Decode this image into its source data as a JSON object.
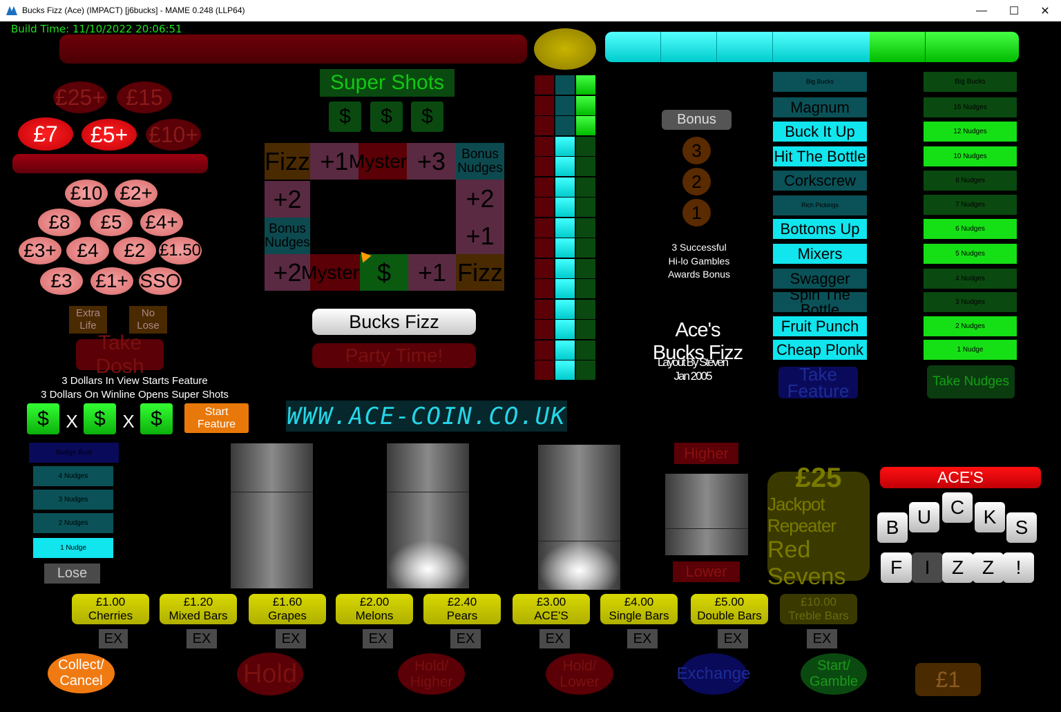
{
  "window": {
    "title": "Bucks Fizz (Ace) (IMPACT) [j6bucks] - MAME 0.248 (LLP64)",
    "minimize": "—",
    "maximize": "☐",
    "close": "✕"
  },
  "build_time": "Build Time: 11/10/2022 20:06:51",
  "cash_ladder": {
    "top": [
      {
        "label": "£25+",
        "lit": false
      },
      {
        "label": "£15",
        "lit": false
      }
    ],
    "row2": [
      {
        "label": "£7",
        "lit": true
      },
      {
        "label": "£5+",
        "lit": true
      },
      {
        "label": "£10+",
        "lit": false
      }
    ]
  },
  "pink_awards": [
    "£10",
    "£2+",
    "£8",
    "£5",
    "£4+",
    "£3+",
    "£4",
    "£2",
    "£1.50",
    "£3",
    "£1+",
    "SSO"
  ],
  "extra_life": "Extra Life",
  "no_lose": "No Lose",
  "take_dosh": "Take Dosh",
  "dollar_info_1": "3 Dollars In View Starts Feature",
  "dollar_info_2": "3 Dollars On Winline Opens Super Shots",
  "dollar_symbol": "$",
  "times": "X",
  "start_feature": "Start Feature",
  "super_shots": "Super Shots",
  "trail": {
    "top": [
      "Fizz",
      "+1",
      "Mystery",
      "+3",
      "Bonus Nudges"
    ],
    "right": [
      "+2",
      "+1"
    ],
    "left": [
      "+2",
      "Bonus Nudges"
    ],
    "bottom": [
      "+2",
      "Mystery",
      "$",
      "+1",
      "Fizz"
    ]
  },
  "bucks_fizz": "Bucks Fizz",
  "party_time": "Party Time!",
  "dot_matrix": "WWW.ACE-COIN.CO.UK",
  "bonus": {
    "label": "Bonus",
    "steps": [
      "3",
      "2",
      "1"
    ],
    "text": [
      "3 Successful",
      "Hi-lo Gambles",
      "Awards Bonus"
    ]
  },
  "game_title": "Ace's Bucks Fizz",
  "layout_credit": "Layout By Steven Jan 2005",
  "features": [
    {
      "label": "Big Bucks",
      "small": true,
      "lit": false
    },
    {
      "label": "Magnum",
      "lit": false
    },
    {
      "label": "Buck It Up",
      "lit": true
    },
    {
      "label": "Hit The Bottle",
      "lit": true
    },
    {
      "label": "Corkscrew",
      "lit": false
    },
    {
      "label": "Rich Pickings",
      "small": true,
      "lit": false
    },
    {
      "label": "Bottoms Up",
      "lit": true
    },
    {
      "label": "Mixers",
      "lit": true
    },
    {
      "label": "Swagger",
      "lit": false
    },
    {
      "label": "Spin The Bottle",
      "lit": false
    },
    {
      "label": "Fruit Punch",
      "lit": true
    },
    {
      "label": "Cheap Plonk",
      "lit": true
    }
  ],
  "take_feature": "Take Feature",
  "nudge_ladder": [
    {
      "label": "Big Bucks",
      "lit": false
    },
    {
      "label": "16 Nudges",
      "lit": false
    },
    {
      "label": "12 Nudges",
      "lit": true
    },
    {
      "label": "10 Nudges",
      "lit": true
    },
    {
      "label": "8 Nudges",
      "lit": false
    },
    {
      "label": "7 Nudges",
      "lit": false
    },
    {
      "label": "6 Nudges",
      "lit": true
    },
    {
      "label": "5 Nudges",
      "lit": true
    },
    {
      "label": "4 Nudges",
      "lit": false
    },
    {
      "label": "3 Nudges",
      "lit": false
    },
    {
      "label": "2 Nudges",
      "lit": true
    },
    {
      "label": "1 Nudge",
      "lit": true
    }
  ],
  "take_nudges": "Take Nudges",
  "left_nudges": [
    {
      "label": "Nudge Bust",
      "dark": true
    },
    {
      "label": "4 Nudges",
      "lit": false
    },
    {
      "label": "3 Nudges",
      "lit": false
    },
    {
      "label": "2 Nudges",
      "lit": false
    },
    {
      "label": "1 Nudge",
      "lit": true
    }
  ],
  "lose": "Lose",
  "higher": "Higher",
  "lower": "Lower",
  "jackpot": {
    "amount": "£25",
    "line1": "Jackpot Repeater",
    "line2": "Red Sevens"
  },
  "aces": "ACE'S",
  "tiles_top": [
    "B",
    "U",
    "C",
    "K",
    "S"
  ],
  "tiles_bottom": [
    "F",
    "I",
    "Z",
    "Z",
    "!"
  ],
  "paytable": [
    {
      "amount": "£1.00",
      "symbol": "Cherries",
      "lit": true
    },
    {
      "amount": "£1.20",
      "symbol": "Mixed Bars",
      "lit": true
    },
    {
      "amount": "£1.60",
      "symbol": "Grapes",
      "lit": true
    },
    {
      "amount": "£2.00",
      "symbol": "Melons",
      "lit": true
    },
    {
      "amount": "£2.40",
      "symbol": "Pears",
      "lit": true
    },
    {
      "amount": "£3.00",
      "symbol": "ACE'S",
      "lit": true
    },
    {
      "amount": "£4.00",
      "symbol": "Single Bars",
      "lit": true
    },
    {
      "amount": "£5.00",
      "symbol": "Double Bars",
      "lit": true
    },
    {
      "amount": "£10.00",
      "symbol": "Treble Bars",
      "lit": false
    }
  ],
  "ex": "EX",
  "buttons": {
    "collect": "Collect/ Cancel",
    "hold": "Hold",
    "hold_higher": "Hold/ Higher",
    "hold_lower": "Hold/ Lower",
    "exchange": "Exchange",
    "start_gamble": "Start/ Gamble",
    "stake": "£1"
  },
  "colors": {
    "lit_red": "#e8000c",
    "dim_red": "#5a0006",
    "cyan_lit": "#11e5ee",
    "cyan_dim": "#0a5258",
    "green_lit": "#15e015",
    "green_dim": "#0a4a10"
  }
}
